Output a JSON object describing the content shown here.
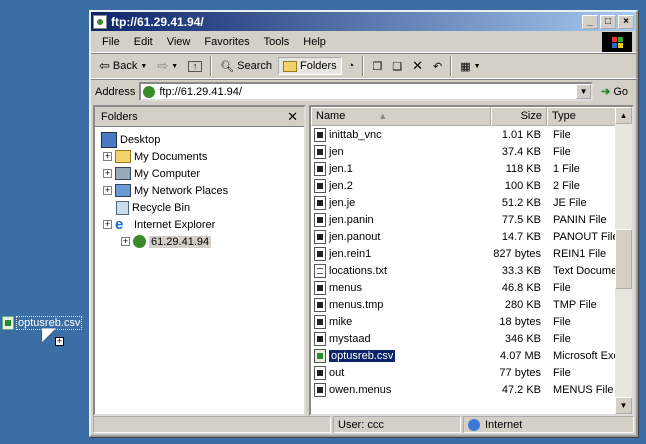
{
  "desktop": {
    "dragged_file": "optusreb.csv"
  },
  "window": {
    "title": "ftp://61.29.41.94/"
  },
  "menu": [
    "File",
    "Edit",
    "View",
    "Favorites",
    "Tools",
    "Help"
  ],
  "toolbar": {
    "back": "Back",
    "search": "Search",
    "folders": "Folders"
  },
  "address": {
    "label": "Address",
    "value": "ftp://61.29.41.94/",
    "go": "Go"
  },
  "folders_pane": {
    "title": "Folders",
    "items": [
      {
        "label": "Desktop",
        "icon": "desktop-icon"
      },
      {
        "label": "My Documents",
        "icon": "folder-icon"
      },
      {
        "label": "My Computer",
        "icon": "computer-icon"
      },
      {
        "label": "My Network Places",
        "icon": "network-icon"
      },
      {
        "label": "Recycle Bin",
        "icon": "recycle-bin-icon"
      },
      {
        "label": "Internet Explorer",
        "icon": "ie-icon"
      },
      {
        "label": "61.29.41.94",
        "icon": "ftp-icon"
      }
    ]
  },
  "columns": {
    "name": "Name",
    "size": "Size",
    "type": "Type"
  },
  "files": [
    {
      "name": "inittab_vnc",
      "size": "1.01 KB",
      "type": "File"
    },
    {
      "name": "jen",
      "size": "37.4 KB",
      "type": "File"
    },
    {
      "name": "jen.1",
      "size": "118 KB",
      "type": "1 File"
    },
    {
      "name": "jen.2",
      "size": "100 KB",
      "type": "2 File"
    },
    {
      "name": "jen.je",
      "size": "51.2 KB",
      "type": "JE File"
    },
    {
      "name": "jen.panin",
      "size": "77.5 KB",
      "type": "PANIN File"
    },
    {
      "name": "jen.panout",
      "size": "14.7 KB",
      "type": "PANOUT File"
    },
    {
      "name": "jen.rein1",
      "size": "827 bytes",
      "type": "REIN1 File"
    },
    {
      "name": "locations.txt",
      "size": "33.3 KB",
      "type": "Text Documen"
    },
    {
      "name": "menus",
      "size": "46.8 KB",
      "type": "File"
    },
    {
      "name": "menus.tmp",
      "size": "280 KB",
      "type": "TMP File"
    },
    {
      "name": "mike",
      "size": "18 bytes",
      "type": "File"
    },
    {
      "name": "mystaad",
      "size": "346 KB",
      "type": "File"
    },
    {
      "name": "optusreb.csv",
      "size": "4.07 MB",
      "type": "Microsoft Exc"
    },
    {
      "name": "out",
      "size": "77 bytes",
      "type": "File"
    },
    {
      "name": "owen.menus",
      "size": "47.2 KB",
      "type": "MENUS File"
    }
  ],
  "status": {
    "user": "User: ccc",
    "zone": "Internet"
  }
}
